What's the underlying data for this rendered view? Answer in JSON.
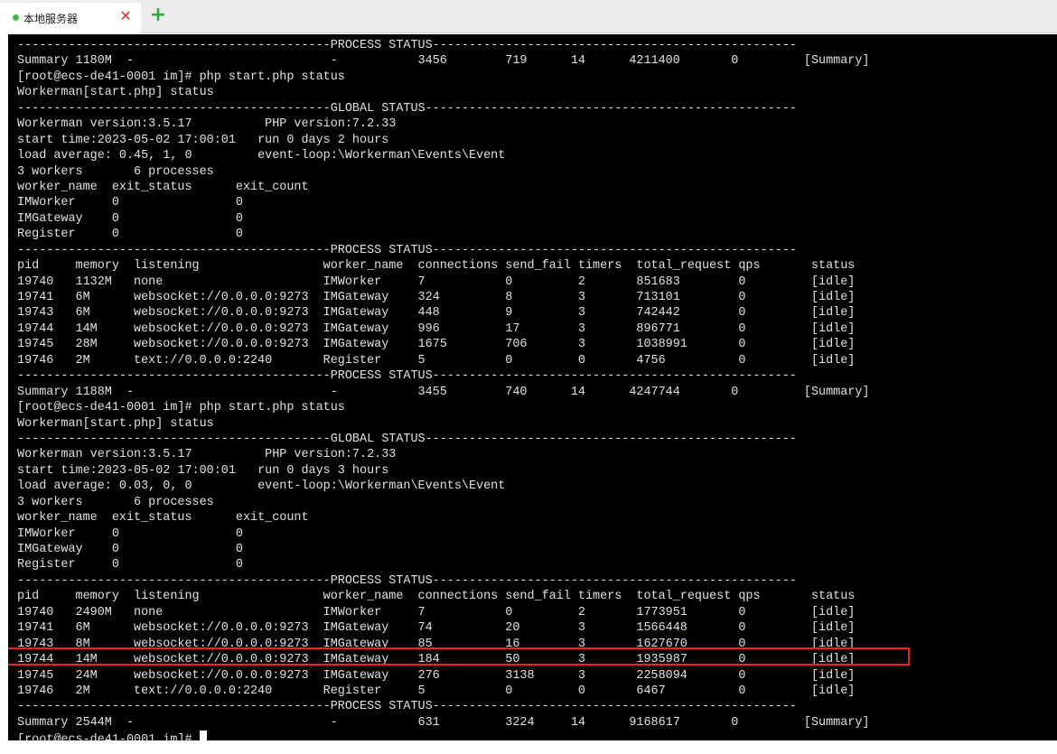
{
  "tabs": [
    {
      "label": "本地服务器",
      "status_color": "#3cba4f"
    }
  ],
  "icons": {
    "status_dot": "green-dot",
    "close": "close-x",
    "new_tab": "plus"
  },
  "colors": {
    "terminal_bg": "#000000",
    "terminal_fg": "#e0e0e0",
    "highlight_border": "#e8281c"
  },
  "terminal": {
    "highlighted_line_index": 40,
    "lines": [
      "-------------------------------------------PROCESS STATUS--------------------------------------------------",
      "Summary 1180M  -                           -           3456        719      14      4211400       0         [Summary]",
      "[root@ecs-de41-0001 im]# php start.php status",
      "Workerman[start.php] status",
      "-------------------------------------------GLOBAL STATUS---------------------------------------------------",
      "Workerman version:3.5.17          PHP version:7.2.33",
      "start time:2023-05-02 17:00:01   run 0 days 2 hours",
      "load average: 0.45, 1, 0         event-loop:\\Workerman\\Events\\Event",
      "3 workers       6 processes",
      "worker_name  exit_status      exit_count",
      "IMWorker     0                0",
      "IMGateway    0                0",
      "Register     0                0",
      "-------------------------------------------PROCESS STATUS--------------------------------------------------",
      "pid     memory  listening                 worker_name  connections send_fail timers  total_request qps       status",
      "19740   1132M   none                      IMWorker     7           0         2       851683        0         [idle]",
      "19741   6M      websocket://0.0.0.0:9273  IMGateway    324         8         3       713101        0         [idle]",
      "19743   6M      websocket://0.0.0.0:9273  IMGateway    448         9         3       742442        0         [idle]",
      "19744   14M     websocket://0.0.0.0:9273  IMGateway    996         17        3       896771        0         [idle]",
      "19745   28M     websocket://0.0.0.0:9273  IMGateway    1675        706       3       1038991       0         [idle]",
      "19746   2M      text://0.0.0.0:2240       Register     5           0         0       4756          0         [idle]",
      "-------------------------------------------PROCESS STATUS--------------------------------------------------",
      "Summary 1188M  -                           -           3455        740      14      4247744       0         [Summary]",
      "[root@ecs-de41-0001 im]# php start.php status",
      "Workerman[start.php] status",
      "-------------------------------------------GLOBAL STATUS---------------------------------------------------",
      "Workerman version:3.5.17          PHP version:7.2.33",
      "start time:2023-05-02 17:00:01   run 0 days 3 hours",
      "load average: 0.03, 0, 0         event-loop:\\Workerman\\Events\\Event",
      "3 workers       6 processes",
      "worker_name  exit_status      exit_count",
      "IMWorker     0                0",
      "IMGateway    0                0",
      "Register     0                0",
      "-------------------------------------------PROCESS STATUS--------------------------------------------------",
      "pid     memory  listening                 worker_name  connections send_fail timers  total_request qps       status",
      "19740   2490M   none                      IMWorker     7           0         2       1773951       0         [idle]",
      "19741   6M      websocket://0.0.0.0:9273  IMGateway    74          20        3       1566448       0         [idle]",
      "19743   8M      websocket://0.0.0.0:9273  IMGateway    85          16        3       1627670       0         [idle]",
      "19744   14M     websocket://0.0.0.0:9273  IMGateway    184         50        3       1935987       0         [idle]",
      "19745   24M     websocket://0.0.0.0:9273  IMGateway    276         3138      3       2258094       0         [idle]",
      "19746   2M      text://0.0.0.0:2240       Register     5           0         0       6467          0         [idle]",
      "-------------------------------------------PROCESS STATUS--------------------------------------------------",
      "Summary 2544M  -                           -           631         3224     14      9168617       0         [Summary]"
    ],
    "prompt": "[root@ecs-de41-0001 im]# "
  }
}
